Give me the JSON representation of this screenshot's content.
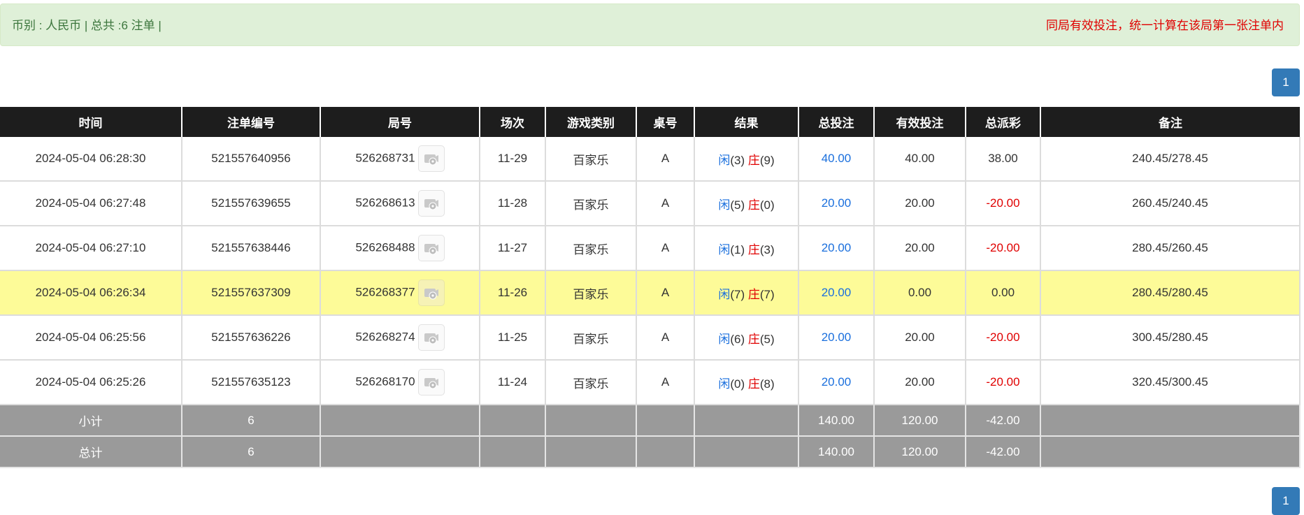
{
  "banner": {
    "left_text": "币别 : 人民币 | 总共 :6 注单 |",
    "right_text": "同局有效投注，统一计算在该局第一张注单内"
  },
  "pagination": {
    "current_page": "1"
  },
  "table": {
    "headers": [
      "时间",
      "注单编号",
      "局号",
      "场次",
      "游戏类别",
      "桌号",
      "结果",
      "总投注",
      "有效投注",
      "总派彩",
      "备注"
    ],
    "rows": [
      {
        "time": "2024-05-04 06:28:30",
        "bet_id": "521557640956",
        "round_id": "526268731",
        "session": "11-29",
        "game": "百家乐",
        "table_no": "A",
        "player_label": "闲",
        "player": "(3)",
        "banker_label": "庄",
        "banker": "(9)",
        "total_bet": "40.00",
        "valid_bet": "40.00",
        "payout": "38.00",
        "payout_negative": false,
        "note": "240.45/278.45",
        "highlight": false
      },
      {
        "time": "2024-05-04 06:27:48",
        "bet_id": "521557639655",
        "round_id": "526268613",
        "session": "11-28",
        "game": "百家乐",
        "table_no": "A",
        "player_label": "闲",
        "player": "(5)",
        "banker_label": "庄",
        "banker": "(0)",
        "total_bet": "20.00",
        "valid_bet": "20.00",
        "payout": "-20.00",
        "payout_negative": true,
        "note": "260.45/240.45",
        "highlight": false
      },
      {
        "time": "2024-05-04 06:27:10",
        "bet_id": "521557638446",
        "round_id": "526268488",
        "session": "11-27",
        "game": "百家乐",
        "table_no": "A",
        "player_label": "闲",
        "player": "(1)",
        "banker_label": "庄",
        "banker": "(3)",
        "total_bet": "20.00",
        "valid_bet": "20.00",
        "payout": "-20.00",
        "payout_negative": true,
        "note": "280.45/260.45",
        "highlight": false
      },
      {
        "time": "2024-05-04 06:26:34",
        "bet_id": "521557637309",
        "round_id": "526268377",
        "session": "11-26",
        "game": "百家乐",
        "table_no": "A",
        "player_label": "闲",
        "player": "(7)",
        "banker_label": "庄",
        "banker": "(7)",
        "total_bet": "20.00",
        "valid_bet": "0.00",
        "payout": "0.00",
        "payout_negative": false,
        "note": "280.45/280.45",
        "highlight": true
      },
      {
        "time": "2024-05-04 06:25:56",
        "bet_id": "521557636226",
        "round_id": "526268274",
        "session": "11-25",
        "game": "百家乐",
        "table_no": "A",
        "player_label": "闲",
        "player": "(6)",
        "banker_label": "庄",
        "banker": "(5)",
        "total_bet": "20.00",
        "valid_bet": "20.00",
        "payout": "-20.00",
        "payout_negative": true,
        "note": "300.45/280.45",
        "highlight": false
      },
      {
        "time": "2024-05-04 06:25:26",
        "bet_id": "521557635123",
        "round_id": "526268170",
        "session": "11-24",
        "game": "百家乐",
        "table_no": "A",
        "player_label": "闲",
        "player": "(0)",
        "banker_label": "庄",
        "banker": "(8)",
        "total_bet": "20.00",
        "valid_bet": "20.00",
        "payout": "-20.00",
        "payout_negative": true,
        "note": "320.45/300.45",
        "highlight": false
      }
    ],
    "subtotal": {
      "label": "小计",
      "count": "6",
      "total_bet": "140.00",
      "valid_bet": "120.00",
      "payout": "-42.00"
    },
    "total": {
      "label": "总计",
      "count": "6",
      "total_bet": "140.00",
      "valid_bet": "120.00",
      "payout": "-42.00"
    }
  },
  "icons": {
    "replay": "video-replay-icon"
  },
  "colors": {
    "blue": "#1a6fdd",
    "red": "#e00000",
    "header_bg": "#1d1d1d",
    "highlight_row": "#fdfb98",
    "summary_bg": "#9a9a9a",
    "banner_bg": "#dff0d8"
  }
}
